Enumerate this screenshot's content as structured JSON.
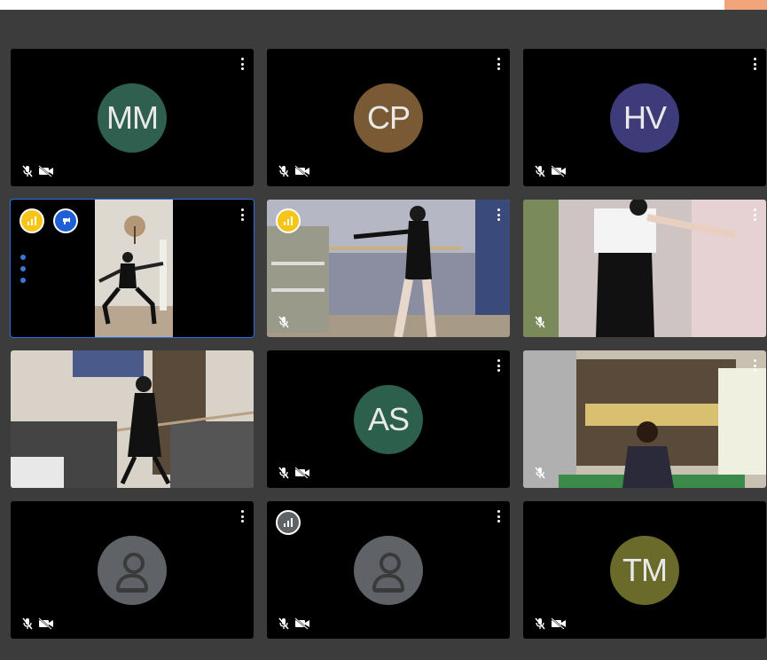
{
  "colors": {
    "page_bg": "#3c3c3c",
    "tile_bg": "#000000",
    "active_outline": "#2b6fe0",
    "top_accent": "#f2a57a",
    "avatar_mm": "#2f5f4f",
    "avatar_cp": "#7a5a35",
    "avatar_hv": "#3d3b7a",
    "avatar_as": "#2c5f4c",
    "avatar_tm": "#6a6a2b"
  },
  "tiles": [
    {
      "kind": "avatar",
      "initials": "MM",
      "mic": "muted",
      "camera": "off"
    },
    {
      "kind": "avatar",
      "initials": "CP",
      "mic": "muted",
      "camera": "off"
    },
    {
      "kind": "avatar",
      "initials": "HV",
      "mic": "muted",
      "camera": "off"
    },
    {
      "kind": "video",
      "active": true,
      "badges": [
        "audio-level-icon",
        "pin-icon"
      ],
      "scene": "dancer-in-doorway"
    },
    {
      "kind": "video",
      "badges": [
        "audio-level-icon"
      ],
      "scene": "dancer-at-barre"
    },
    {
      "kind": "video",
      "scene": "dancer-arms-out"
    },
    {
      "kind": "video",
      "scene": "dancer-living-room"
    },
    {
      "kind": "avatar",
      "initials": "AS",
      "mic": "muted",
      "camera": "off"
    },
    {
      "kind": "video",
      "scene": "dancer-bedroom",
      "mic": "muted"
    },
    {
      "kind": "generic-avatar",
      "mic": "muted",
      "camera": "off"
    },
    {
      "kind": "generic-avatar",
      "badges": [
        "audio-level-icon"
      ],
      "mic": "muted",
      "camera": "off"
    },
    {
      "kind": "avatar",
      "initials": "TM",
      "mic": "muted",
      "camera": "off"
    }
  ]
}
